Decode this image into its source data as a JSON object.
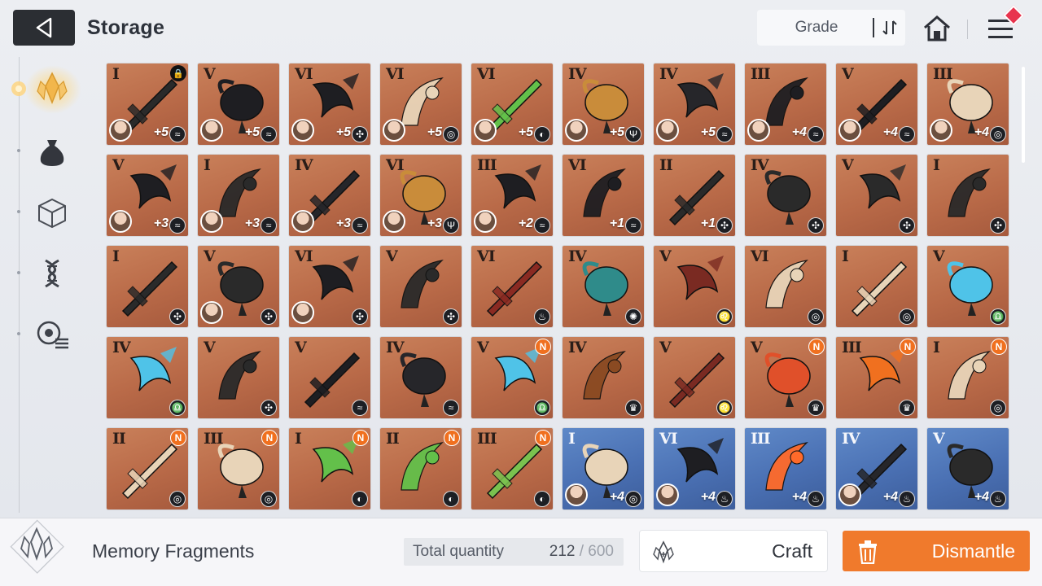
{
  "header": {
    "title": "Storage",
    "grade_label": "Grade"
  },
  "sidebar": {
    "tabs": [
      {
        "name": "memory-fragments-tab",
        "icon": "crystal-icon",
        "active": true
      },
      {
        "name": "supplies-tab",
        "icon": "bag-icon",
        "active": false
      },
      {
        "name": "materials-tab",
        "icon": "cube-icon",
        "active": false
      },
      {
        "name": "genes-tab",
        "icon": "dna-icon",
        "active": false
      },
      {
        "name": "list-tab",
        "icon": "list-settings-icon",
        "active": false
      }
    ]
  },
  "items": [
    {
      "grade": "I",
      "plus": "+5",
      "avatar": true,
      "type": "≈",
      "lock": true,
      "color": "#2a2a2a"
    },
    {
      "grade": "V",
      "plus": "+5",
      "avatar": true,
      "type": "≈",
      "color": "#1e1e22"
    },
    {
      "grade": "VI",
      "plus": "+5",
      "avatar": true,
      "type": "✣",
      "color": "#1e1e22"
    },
    {
      "grade": "VI",
      "plus": "+5",
      "avatar": true,
      "type": "◎",
      "color": "#e8d4b8"
    },
    {
      "grade": "VI",
      "plus": "+5",
      "avatar": true,
      "type": "◐",
      "color": "#63c04a"
    },
    {
      "grade": "IV",
      "plus": "+5",
      "avatar": true,
      "type": "Ψ",
      "color": "#c98c3a"
    },
    {
      "grade": "IV",
      "plus": "+5",
      "avatar": true,
      "type": "≈",
      "color": "#26262a"
    },
    {
      "grade": "III",
      "plus": "+4",
      "avatar": true,
      "type": "≈",
      "color": "#1e1e22"
    },
    {
      "grade": "V",
      "plus": "+4",
      "avatar": true,
      "type": "≈",
      "color": "#1e1e22"
    },
    {
      "grade": "III",
      "plus": "+4",
      "avatar": true,
      "type": "◎",
      "color": "#e8d4b8"
    },
    {
      "grade": "V",
      "plus": "+3",
      "avatar": true,
      "type": "≈",
      "color": "#1e1e22"
    },
    {
      "grade": "I",
      "plus": "+3",
      "avatar": true,
      "type": "≈",
      "color": "#2a2a2a"
    },
    {
      "grade": "IV",
      "plus": "+3",
      "avatar": true,
      "type": "≈",
      "color": "#26262a"
    },
    {
      "grade": "VI",
      "plus": "+3",
      "avatar": true,
      "type": "Ψ",
      "color": "#c98c3a"
    },
    {
      "grade": "III",
      "plus": "+2",
      "avatar": true,
      "type": "≈",
      "color": "#1e1e22"
    },
    {
      "grade": "VI",
      "plus": "+1",
      "avatar": false,
      "type": "≈",
      "color": "#1e1e22"
    },
    {
      "grade": "II",
      "plus": "+1",
      "avatar": false,
      "type": "✣",
      "color": "#2a2a2a"
    },
    {
      "grade": "IV",
      "plus": "",
      "avatar": false,
      "type": "✣",
      "color": "#2a2a2a"
    },
    {
      "grade": "V",
      "plus": "",
      "avatar": false,
      "type": "✣",
      "color": "#2a2a2a"
    },
    {
      "grade": "I",
      "plus": "",
      "avatar": false,
      "type": "✣",
      "color": "#2a2a2a"
    },
    {
      "grade": "I",
      "plus": "",
      "avatar": false,
      "type": "✣",
      "color": "#2a2a2a"
    },
    {
      "grade": "V",
      "plus": "",
      "avatar": true,
      "type": "✣",
      "color": "#2a2a2a"
    },
    {
      "grade": "VI",
      "plus": "",
      "avatar": true,
      "type": "✣",
      "color": "#1e1e22"
    },
    {
      "grade": "V",
      "plus": "",
      "avatar": false,
      "type": "✣",
      "color": "#2a2a2a"
    },
    {
      "grade": "VI",
      "plus": "",
      "avatar": false,
      "type": "♨",
      "color": "#8a2a22"
    },
    {
      "grade": "IV",
      "plus": "",
      "avatar": false,
      "type": "✺",
      "color": "#2f8b8a"
    },
    {
      "grade": "V",
      "plus": "",
      "avatar": false,
      "type": "♌",
      "color": "#7a2a22"
    },
    {
      "grade": "VI",
      "plus": "",
      "avatar": false,
      "type": "◎",
      "color": "#e8d4b8"
    },
    {
      "grade": "I",
      "plus": "",
      "avatar": false,
      "type": "◎",
      "color": "#e8d4b8"
    },
    {
      "grade": "V",
      "plus": "",
      "avatar": false,
      "type": "♎",
      "color": "#4fc3e8"
    },
    {
      "grade": "IV",
      "plus": "",
      "avatar": false,
      "type": "♎",
      "color": "#4fc3e8"
    },
    {
      "grade": "V",
      "plus": "",
      "avatar": false,
      "type": "✣",
      "color": "#2a2a2a"
    },
    {
      "grade": "V",
      "plus": "",
      "avatar": false,
      "type": "≈",
      "color": "#1e1e22"
    },
    {
      "grade": "IV",
      "plus": "",
      "avatar": false,
      "type": "≈",
      "color": "#26262a"
    },
    {
      "grade": "V",
      "plus": "",
      "avatar": false,
      "type": "♎",
      "new": true,
      "color": "#4fc3e8"
    },
    {
      "grade": "IV",
      "plus": "",
      "avatar": false,
      "type": "♛",
      "color": "#8a4a22"
    },
    {
      "grade": "V",
      "plus": "",
      "avatar": false,
      "type": "♌",
      "color": "#7a2a22"
    },
    {
      "grade": "V",
      "plus": "",
      "avatar": false,
      "type": "♛",
      "new": true,
      "color": "#e0502a"
    },
    {
      "grade": "III",
      "plus": "",
      "avatar": false,
      "type": "♛",
      "new": true,
      "color": "#f0701f"
    },
    {
      "grade": "I",
      "plus": "",
      "avatar": false,
      "type": "◎",
      "new": true,
      "color": "#e8d4b8"
    },
    {
      "grade": "II",
      "plus": "",
      "avatar": false,
      "type": "◎",
      "new": true,
      "color": "#e8d4b8"
    },
    {
      "grade": "III",
      "plus": "",
      "avatar": false,
      "type": "◎",
      "new": true,
      "color": "#e8d4b8"
    },
    {
      "grade": "I",
      "plus": "",
      "avatar": false,
      "type": "◐",
      "new": true,
      "color": "#63c04a"
    },
    {
      "grade": "II",
      "plus": "",
      "avatar": false,
      "type": "◐",
      "new": true,
      "color": "#63c04a"
    },
    {
      "grade": "III",
      "plus": "",
      "avatar": false,
      "type": "◐",
      "new": true,
      "color": "#7ac24f"
    },
    {
      "grade": "I",
      "plus": "+4",
      "avatar": true,
      "type": "◎",
      "blue": true,
      "color": "#e8d4b8"
    },
    {
      "grade": "VI",
      "plus": "+4",
      "avatar": true,
      "type": "♨",
      "blue": true,
      "color": "#1e1e22"
    },
    {
      "grade": "III",
      "plus": "+4",
      "avatar": false,
      "type": "♨",
      "blue": true,
      "color": "#ff6a2a"
    },
    {
      "grade": "IV",
      "plus": "+4",
      "avatar": true,
      "type": "♨",
      "blue": true,
      "color": "#26262a"
    },
    {
      "grade": "V",
      "plus": "+4",
      "avatar": false,
      "type": "♨",
      "blue": true,
      "color": "#2a2a2a"
    }
  ],
  "footer": {
    "category": "Memory Fragments",
    "total_label": "Total quantity",
    "total_current": "212",
    "total_sep": " / ",
    "total_max": "600",
    "craft_label": "Craft",
    "dismantle_label": "Dismantle"
  },
  "colors": {
    "accent": "#f07a2c",
    "new_badge": "#f0701f",
    "card_bronze": "#c07452",
    "card_blue": "#4a70b3"
  }
}
